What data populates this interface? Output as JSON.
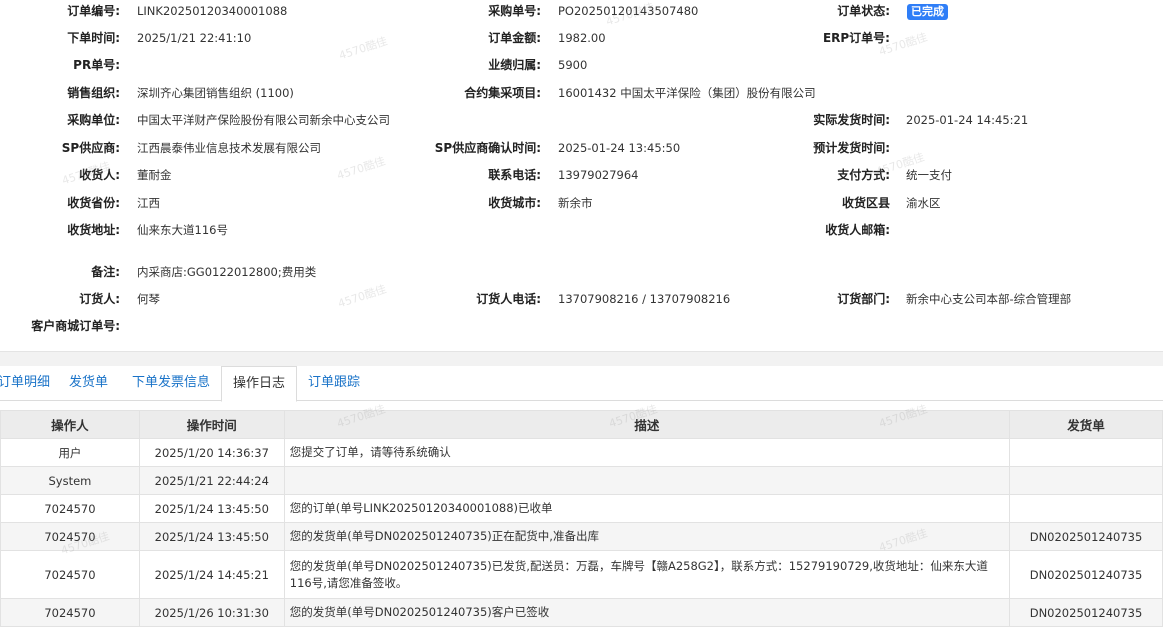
{
  "order": {
    "order_no_label": "订单编号:",
    "order_no": "LINK20250120340001088",
    "purchase_no_label": "采购单号:",
    "purchase_no": "PO20250120143507480",
    "status_label": "订单状态:",
    "status": "已完成",
    "order_time_label": "下单时间:",
    "order_time": "2025/1/21 22:41:10",
    "amount_label": "订单金额:",
    "amount": "1982.00",
    "erp_label": "ERP订单号:",
    "pr_label": "PR单号:",
    "perf_label": "业绩归属:",
    "perf": "5900",
    "sales_org_label": "销售组织:",
    "sales_org": "深圳齐心集团销售组织 (1100)",
    "contract_label": "合约集采项目:",
    "contract": "16001432 中国太平洋保险（集团）股份有限公司",
    "buyer_unit_label": "采购单位:",
    "buyer_unit": "中国太平洋财产保险股份有限公司新余中心支公司",
    "actual_ship_label": "实际发货时间:",
    "actual_ship": "2025-01-24 14:45:21",
    "sp_supplier_label": "SP供应商:",
    "sp_supplier": "江西晨泰伟业信息技术发展有限公司",
    "sp_confirm_label": "SP供应商确认时间:",
    "sp_confirm": "2025-01-24 13:45:50",
    "plan_ship_label": "预计发货时间:",
    "receiver_label": "收货人:",
    "receiver": "董耐金",
    "phone_label": "联系电话:",
    "phone": "13979027964",
    "pay_label": "支付方式:",
    "pay": "统一支付",
    "province_label": "收货省份:",
    "province": "江西",
    "city_label": "收货城市:",
    "city": "新余市",
    "district_label": "收货区县",
    "district": "渝水区",
    "address_label": "收货地址:",
    "address": "仙来东大道116号",
    "email_label": "收货人邮箱:",
    "remark_label": "备注:",
    "remark": "内采商店:GG0122012800;费用类",
    "orderer_label": "订货人:",
    "orderer": "何琴",
    "orderer_phone_label": "订货人电话:",
    "orderer_phone": "13707908216 / 13707908216",
    "orderer_dept_label": "订货部门:",
    "orderer_dept": "新余中心支公司本部-综合管理部",
    "customer_order_label": "客户商城订单号:"
  },
  "tabs": [
    "订单明细",
    "发货单",
    "下单发票信息",
    "操作日志",
    "订单跟踪"
  ],
  "log": {
    "headers": [
      "操作人",
      "操作时间",
      "描述",
      "发货单"
    ],
    "rows": [
      {
        "operator": "用户",
        "time": "2025/1/20 14:36:37",
        "desc": "您提交了订单，请等待系统确认",
        "ship": ""
      },
      {
        "operator": "System",
        "time": "2025/1/21 22:44:24",
        "desc": "",
        "ship": ""
      },
      {
        "operator": "7024570",
        "time": "2025/1/24 13:45:50",
        "desc": "您的订单(单号LINK20250120340001088)已收单",
        "ship": ""
      },
      {
        "operator": "7024570",
        "time": "2025/1/24 13:45:50",
        "desc": "您的发货单(单号DN0202501240735)正在配货中,准备出库",
        "ship": "DN0202501240735"
      },
      {
        "operator": "7024570",
        "time": "2025/1/24 14:45:21",
        "desc": "您的发货单(单号DN0202501240735)已发货,配送员：万磊，车牌号【赣A258G2】，联系方式：15279190729,收货地址：仙来东大道116号,请您准备签收。",
        "ship": "DN0202501240735"
      },
      {
        "operator": "7024570",
        "time": "2025/1/26 10:31:30",
        "desc": "您的发货单(单号DN0202501240735)客户已签收",
        "ship": "DN0202501240735"
      }
    ]
  },
  "watermark": "4570酷佳"
}
